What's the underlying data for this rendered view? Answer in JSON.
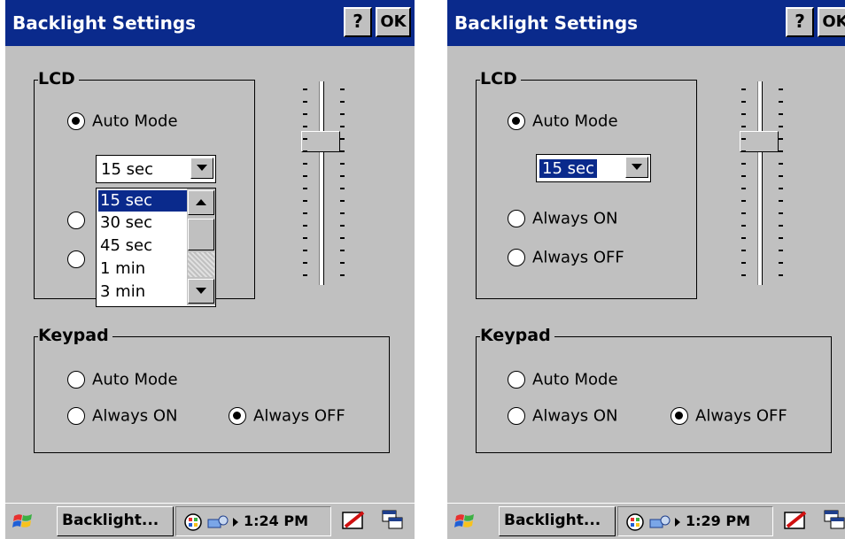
{
  "screens": [
    {
      "title": "Backlight Settings",
      "help_label": "?",
      "ok_label": "OK",
      "lcd": {
        "label": "LCD",
        "auto_mode_label": "Auto Mode",
        "auto_mode_selected": true,
        "timeout_value": "15 sec",
        "dropdown_open": true,
        "dropdown_options": [
          "15 sec",
          "30 sec",
          "45 sec",
          "1 min",
          "3 min"
        ],
        "dropdown_selected_index": 0,
        "brightness_level_fraction": 0.25
      },
      "keypad": {
        "label": "Keypad",
        "auto_mode_label": "Auto Mode",
        "always_on_label": "Always ON",
        "always_off_label": "Always OFF",
        "selected": "Always OFF"
      },
      "taskbar": {
        "task_label": "Backlight...",
        "time": "1:24 PM"
      }
    },
    {
      "title": "Backlight Settings",
      "help_label": "?",
      "ok_label": "OK",
      "lcd": {
        "label": "LCD",
        "auto_mode_label": "Auto Mode",
        "always_on_label": "Always ON",
        "always_off_label": "Always OFF",
        "selected": "Auto Mode",
        "timeout_value": "15 sec",
        "dropdown_open": false,
        "brightness_level_fraction": 0.25
      },
      "keypad": {
        "label": "Keypad",
        "auto_mode_label": "Auto Mode",
        "always_on_label": "Always ON",
        "always_off_label": "Always OFF",
        "selected": "Always OFF"
      },
      "taskbar": {
        "task_label": "Backlight...",
        "time": "1:29 PM"
      }
    }
  ],
  "colors": {
    "titlebar": "#0a2a8c",
    "dialog_bg": "#c0c0c0",
    "selection": "#0a2a8c"
  },
  "icons": {
    "start": "windows-flag-icon",
    "tray": [
      "network-icon",
      "connection-icon"
    ],
    "keyboard": "sip-keyboard-icon",
    "switch": "switch-windows-icon"
  }
}
